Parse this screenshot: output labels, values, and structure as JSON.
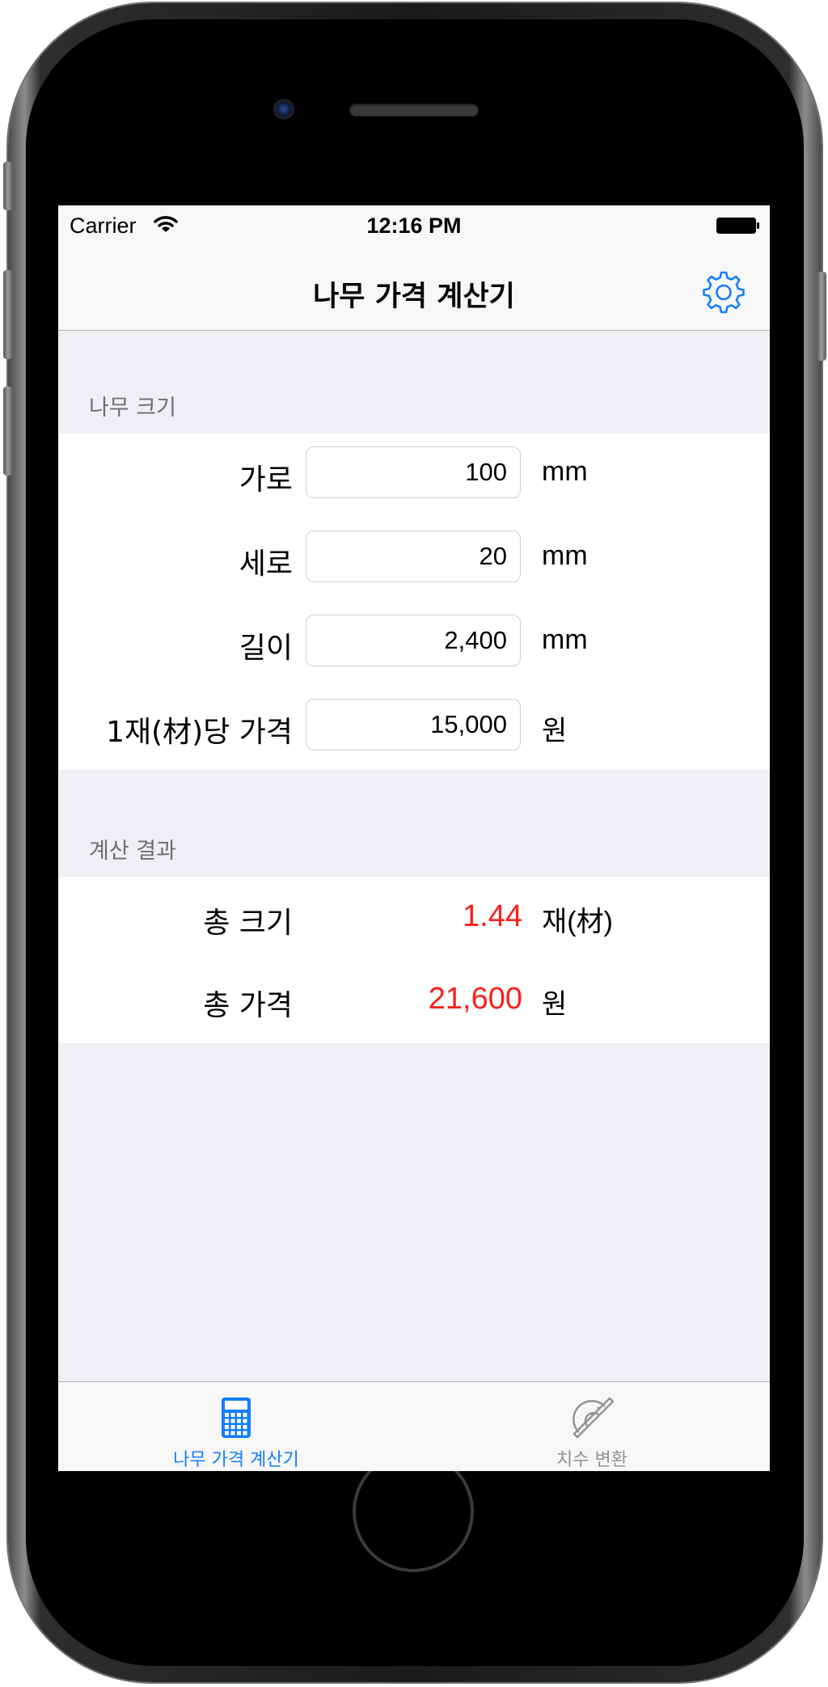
{
  "status_bar": {
    "carrier": "Carrier",
    "time": "12:16 PM"
  },
  "nav": {
    "title": "나무 가격 계산기",
    "settings_icon": "gear-icon"
  },
  "size_section": {
    "header": "나무 크기",
    "rows": [
      {
        "label": "가로",
        "value": "100",
        "unit": "mm"
      },
      {
        "label": "세로",
        "value": "20",
        "unit": "mm"
      },
      {
        "label": "길이",
        "value": "2,400",
        "unit": "mm"
      },
      {
        "label": "1재(材)당 가격",
        "value": "15,000",
        "unit": "원"
      }
    ]
  },
  "result_section": {
    "header": "계산 결과",
    "rows": [
      {
        "label": "총 크기",
        "value": "1.44",
        "unit": "재(材)"
      },
      {
        "label": "총 가격",
        "value": "21,600",
        "unit": "원"
      }
    ]
  },
  "tab_bar": {
    "tabs": [
      {
        "label": "나무 가격 계산기",
        "icon": "calculator-icon",
        "selected": true
      },
      {
        "label": "치수 변환",
        "icon": "protractor-icon",
        "selected": false
      }
    ]
  },
  "colors": {
    "accent": "#147efb",
    "result_value": "#ff1d1d",
    "inactive_tab": "#929292"
  }
}
